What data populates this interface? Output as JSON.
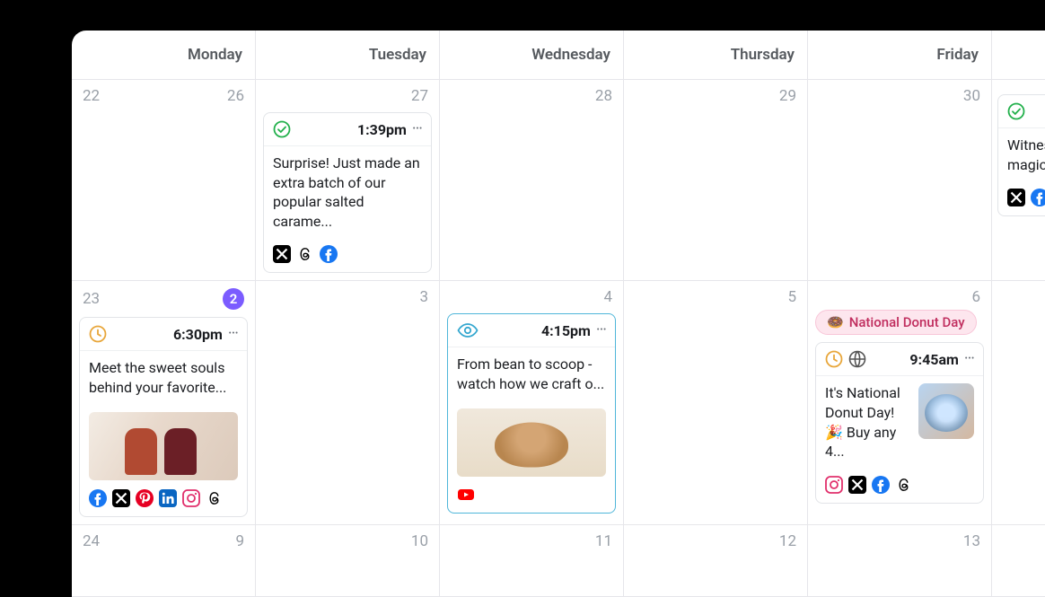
{
  "headers": [
    "Monday",
    "Tuesday",
    "Wednesday",
    "Thursday",
    "Friday",
    ""
  ],
  "weeks": [
    {
      "cells": [
        {
          "left": "22",
          "right": "26"
        },
        {
          "right": "27"
        },
        {
          "right": "28"
        },
        {
          "right": "29"
        },
        {
          "right": "30"
        },
        {
          "right": ""
        }
      ]
    },
    {
      "cells": [
        {
          "left": "23",
          "badge": "2"
        },
        {
          "right": "3"
        },
        {
          "right": "4"
        },
        {
          "right": "5"
        },
        {
          "right": "6"
        },
        {
          "right": ""
        }
      ]
    },
    {
      "cells": [
        {
          "left": "24",
          "right": "9"
        },
        {
          "right": "10"
        },
        {
          "right": "11"
        },
        {
          "right": "12"
        },
        {
          "right": "13"
        },
        {
          "right": ""
        }
      ]
    }
  ],
  "posts": {
    "p1": {
      "time": "1:39pm",
      "status": "check",
      "text": "Surprise! Just made an extra batch of our popular salted carame...",
      "platforms": [
        "x",
        "threads",
        "facebook"
      ]
    },
    "p_fri_top": {
      "status": "check",
      "text": "Witnes\nmagic",
      "platforms": [
        "x",
        "facebook"
      ]
    },
    "p_mon2": {
      "time": "6:30pm",
      "status": "clock",
      "text": "Meet the sweet souls behind your favorite...",
      "platforms": [
        "facebook",
        "x",
        "pinterest",
        "linkedin",
        "instagram",
        "threads"
      ],
      "image": "people"
    },
    "p_wed2": {
      "time": "4:15pm",
      "status": "eye",
      "text": "From bean to scoop - watch how we craft o...",
      "platforms": [
        "youtube"
      ],
      "image": "bean"
    },
    "p_fri2": {
      "pill_emoji": "🍩",
      "pill_text": "National Donut Day",
      "time": "9:45am",
      "status": "clock",
      "globe": true,
      "text": "It's National Donut Day! 🎉 Buy any 4...",
      "platforms": [
        "instagram",
        "x",
        "facebook",
        "threads"
      ],
      "thumb": true
    }
  }
}
